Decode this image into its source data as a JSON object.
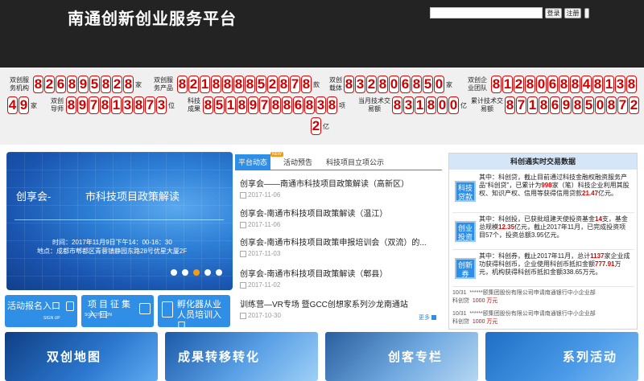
{
  "header": {
    "site_title": "南通创新创业服务平台",
    "login_button": "登录",
    "register_button": "注册"
  },
  "stats": [
    {
      "label": "双创服务机构",
      "digits": "826895828",
      "unit": "家"
    },
    {
      "label": "双创服务产品",
      "digits": "821888852878",
      "unit": "款"
    },
    {
      "label": "双创载体",
      "digits": "832806850",
      "unit": "家"
    },
    {
      "label": "双创企业团队",
      "digits": "812806884813849",
      "unit": "家"
    },
    {
      "label": "双创导师",
      "digits": "897813873",
      "unit": "位"
    },
    {
      "label": "科技成果",
      "digits": "851897886838",
      "unit": "项"
    },
    {
      "label": "当月技术交易额",
      "digits": "831800",
      "unit": "亿"
    },
    {
      "label": "累计技术交易额",
      "digits": "8718698508722",
      "unit": "亿"
    }
  ],
  "slider": {
    "prefix": "创享会-",
    "title": "市科技项目政策解读",
    "time": "时间：2017年11月9日下午14：00-16：30",
    "location": "地点：成都市郫都区青蓉镇静园东路28号优星大厦2F",
    "active_dot": 2
  },
  "quick_buttons": [
    {
      "title": "活动报名入口",
      "sub": "SIGN UP",
      "icon": "register-icon"
    },
    {
      "title": "项目征集入口",
      "sub": "SOLICITATION",
      "icon": "flow-icon"
    },
    {
      "title": "孵化器从业人员培训入口",
      "sub": "",
      "icon": "training-icon"
    }
  ],
  "news": {
    "tabs": [
      "平台动态",
      "活动预告",
      "科技项目立项公示"
    ],
    "new_badge": "NEW",
    "items": [
      {
        "title": "创享会——南通市科技项目政策解读（高新区）",
        "date": "2017-11-06"
      },
      {
        "title": "创享会-南通市科技项目政策解读（温江）",
        "date": "2017-11-06"
      },
      {
        "title": "创享会-南通市科技项目政策申报培训会（双流）的...",
        "date": "2017-11-03"
      },
      {
        "title": "创享会-南通市科技项目政策解读（郫县）",
        "date": "2017-11-02"
      },
      {
        "title": "训练营—VR专场 暨GCC创想家系列沙龙南通站",
        "date": "2017-10-30"
      }
    ],
    "more": "更多"
  },
  "transactions": {
    "title": "科创通实时交易数据",
    "rows": [
      {
        "badge": "科技贷款",
        "text_pre": "其中：科创贷，截止目前通过科技金融权融资服务产品“科创贷”，已累计为",
        "num1": "998",
        "text_mid": "家（笔）科技企业利用其股权、知识产权、信用等获得信用贷款",
        "num2": "21.47",
        "text_post": "亿元。"
      },
      {
        "badge": "创业投资",
        "text_pre": "其中：科创投，已获批组建天使投资基金",
        "num1": "14",
        "text_mid": "支，基金总规模",
        "num2": "12.35",
        "text_post": "亿元，截止2017年11月，已完成投资项目57个，投资总额3.95亿元。"
      },
      {
        "badge": "创新券",
        "text_pre": "其中：科创券，截止2017年11月，总计",
        "num1": "1137",
        "text_mid": "家企业成功获得科创币，企业使用科创币抵扣金额",
        "num2": "777.91",
        "text_post": "万元，机构获得科创币抵扣金额338.65万元。"
      }
    ],
    "list": [
      {
        "date": "10/31",
        "type": "科创贷",
        "company": "******颐集团股份有限公司申请南通银行中小企业部",
        "amount": "1000 万元"
      },
      {
        "date": "10/31",
        "type": "科创贷",
        "company": "******颐集团股份有限公司申请南通银行中小企业部",
        "amount": "1000 万元"
      }
    ]
  },
  "tiles": [
    {
      "label": "双创地图",
      "color": "#1f5fb0"
    },
    {
      "label": "成果转移转化",
      "color": "#2a75c9"
    },
    {
      "label": "创客专栏",
      "color": "#3b7ed3"
    },
    {
      "label": "系列活动",
      "color": "#2f8ee6"
    }
  ]
}
